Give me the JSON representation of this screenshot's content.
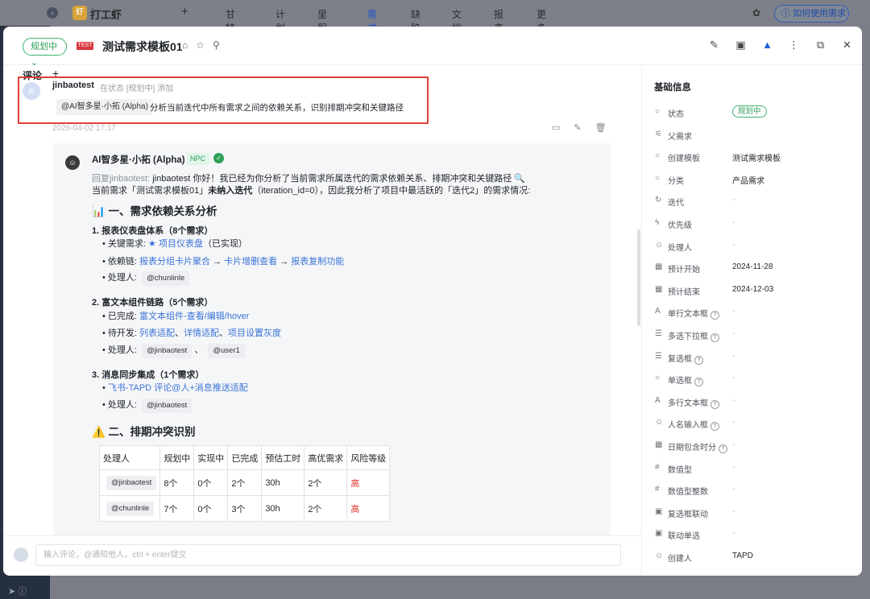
{
  "topbar": {
    "product_name": "打工虾",
    "nav": [
      "甘特图",
      "计划",
      "里程碑",
      "需求",
      "缺陷",
      "文档",
      "报表",
      "更多"
    ],
    "help_label": "如何使用需求"
  },
  "header": {
    "status": "规划中",
    "tag": "TEST",
    "title": "测试需求模板01"
  },
  "comments": {
    "section_title": "评论",
    "add": "+",
    "first": {
      "avatar_letter": "jb",
      "user": "jinbaotest",
      "meta": "在状态 [规划中] 添加",
      "mention": "@AI智多星·小拓 (Alpha)",
      "text": "分析当前迭代中所有需求之间的依赖关系，识别排期冲突和关键路径",
      "time": "2026-04-02 17:17"
    },
    "reply": {
      "bot_name": "AI智多星·小拓 (Alpha)",
      "badge": "NPC",
      "reply_prefix": "回复jinbaotest:",
      "line1": "jinbaotest 你好！我已经为你分析了当前需求所属迭代的需求依赖关系、排期冲突和关键路径 🔍",
      "line2_a": "当前需求「测试需求模板01」",
      "line2_b": "未纳入迭代",
      "line2_c": "（iteration_id=0），因此我分析了项目中最活跃的「迭代2」的需求情况:",
      "h_dep": "📊 一、需求依赖关系分析",
      "g1_title": "1. 报表仪表盘体系（8个需求）",
      "g1_key_label": "关键需求:",
      "g1_key_value": "★ 项目仪表盘",
      "g1_key_note": "（已实现）",
      "g1_chain_label": "依赖链:",
      "g1_chain": [
        "报表分组卡片聚合",
        "卡片增删查看",
        "报表复制功能"
      ],
      "arrow": " → ",
      "owner_label": "处理人:",
      "g1_owners": [
        "@chunlinle"
      ],
      "g2_title": "2. 富文本组件链路（5个需求）",
      "g2_done_label": "已完成:",
      "g2_done": "富文本组件-查看/编辑/hover",
      "g2_todo_label": "待开发:",
      "g2_todo": [
        "列表适配",
        "详情适配",
        "项目设置灰度"
      ],
      "sep": "、",
      "g2_owners": [
        "@jinbaotest",
        "@user1"
      ],
      "g3_title": "3. 消息同步集成（1个需求）",
      "g3_item": "飞书-TAPD 评论@人+消息推送适配",
      "g3_owners": [
        "@jinbaotest"
      ],
      "h_conflict": "⚠️ 二、排期冲突识别",
      "table": {
        "headers": [
          "处理人",
          "规划中",
          "实现中",
          "已完成",
          "预估工时",
          "高优需求",
          "风险等级"
        ],
        "rows": [
          [
            "@jinbaotest",
            "8个",
            "0个",
            "2个",
            "30h",
            "2个",
            "高"
          ],
          [
            "@chunlinle",
            "7个",
            "0个",
            "3个",
            "30h",
            "2个",
            "高"
          ]
        ]
      }
    }
  },
  "input": {
    "placeholder": "输入评论，@通知他人，ctrl + enter提交"
  },
  "side": {
    "title": "基础信息",
    "fields": [
      {
        "label": "状态",
        "value": "规划中",
        "pill": true,
        "icon": "○"
      },
      {
        "label": "父需求",
        "value": "",
        "icon": "⚟"
      },
      {
        "label": "创建模板",
        "value": "测试需求模板",
        "icon": "○"
      },
      {
        "label": "分类",
        "value": "产品需求",
        "icon": "○"
      },
      {
        "label": "迭代",
        "value": "-",
        "icon": "↻"
      },
      {
        "label": "优先级",
        "value": "-",
        "icon": "ϟ"
      },
      {
        "label": "处理人",
        "value": "-",
        "icon": "☺"
      },
      {
        "label": "预计开始",
        "value": "2024-11-28",
        "icon": "▦"
      },
      {
        "label": "预计结束",
        "value": "2024-12-03",
        "icon": "▦"
      },
      {
        "label": "单行文本框",
        "value": "-",
        "icon": "A",
        "help": true
      },
      {
        "label": "多选下拉框",
        "value": "-",
        "icon": "☰",
        "help": true
      },
      {
        "label": "复选框",
        "value": "-",
        "icon": "☰",
        "help": true
      },
      {
        "label": "单选框",
        "value": "-",
        "icon": "○",
        "help": true
      },
      {
        "label": "多行文本框",
        "value": "-",
        "icon": "A",
        "help": true
      },
      {
        "label": "人名输入框",
        "value": "-",
        "icon": "☺",
        "help": true
      },
      {
        "label": "日期包含时分",
        "value": "-",
        "icon": "▦",
        "help": true
      },
      {
        "label": "数值型",
        "value": "-",
        "icon": "#"
      },
      {
        "label": "数值型整数",
        "value": "-",
        "icon": "#"
      },
      {
        "label": "复选框联动",
        "value": "-",
        "icon": "▣"
      },
      {
        "label": "联动单选",
        "value": "-",
        "icon": "▣"
      },
      {
        "label": "创建人",
        "value": "TAPD",
        "icon": "☺"
      }
    ]
  }
}
